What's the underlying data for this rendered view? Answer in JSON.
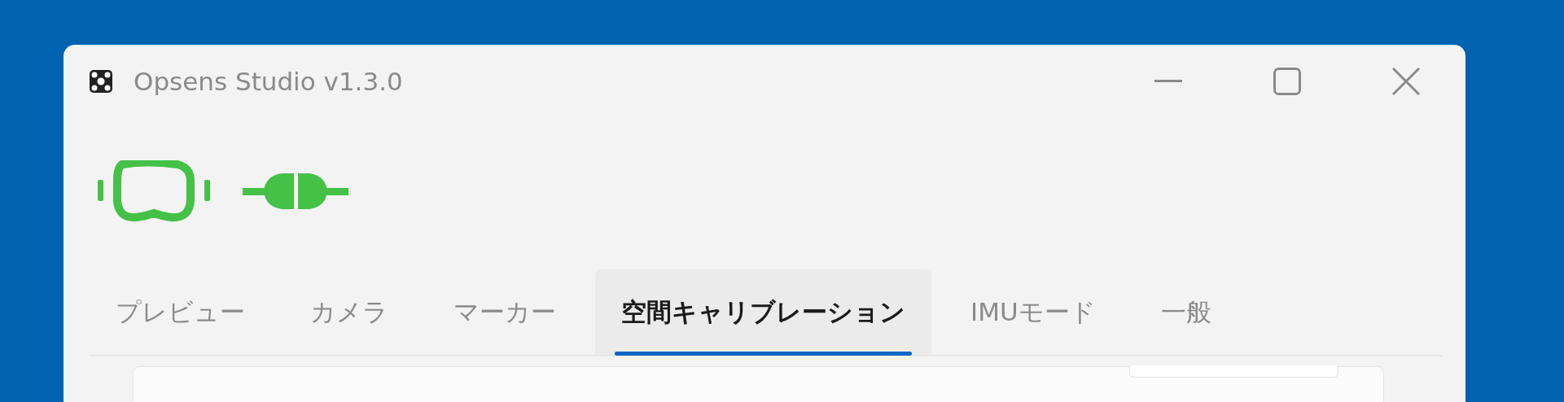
{
  "window": {
    "title": "Opsens Studio v1.3.0"
  },
  "devices": [
    {
      "kind": "headset",
      "connected": true
    },
    {
      "kind": "link",
      "connected": true
    }
  ],
  "tabs": [
    {
      "label": "プレビュー",
      "selected": false
    },
    {
      "label": "カメラ",
      "selected": false
    },
    {
      "label": "マーカー",
      "selected": false
    },
    {
      "label": "空間キャリブレーション",
      "selected": true
    },
    {
      "label": "IMUモード",
      "selected": false
    },
    {
      "label": "一般",
      "selected": false
    }
  ]
}
